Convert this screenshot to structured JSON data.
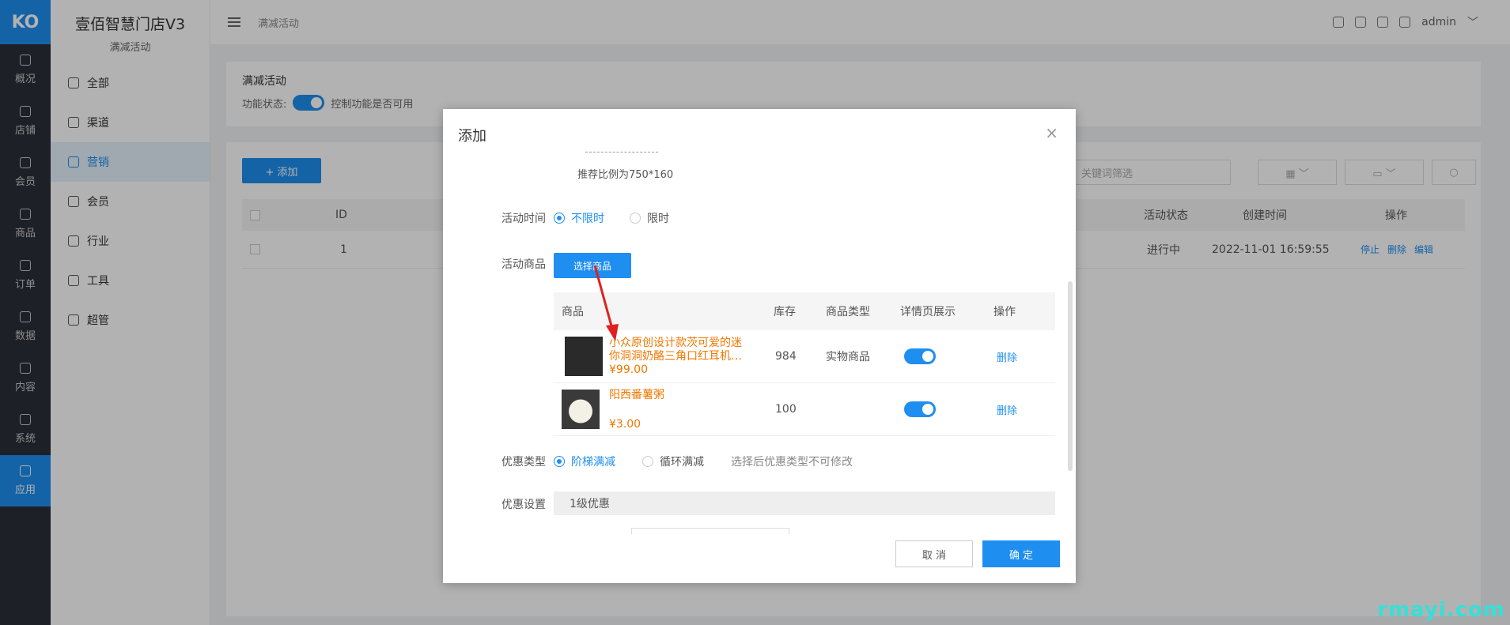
{
  "rail": {
    "logo": "KO",
    "items": [
      {
        "label": "概况"
      },
      {
        "label": "店铺"
      },
      {
        "label": "会员"
      },
      {
        "label": "商品"
      },
      {
        "label": "订单"
      },
      {
        "label": "数据"
      },
      {
        "label": "内容"
      },
      {
        "label": "系统"
      },
      {
        "label": "应用"
      }
    ],
    "active_index": 8
  },
  "sidebar": {
    "brand": "壹佰智慧门店V3",
    "subtitle": "满减活动",
    "items": [
      {
        "label": "全部"
      },
      {
        "label": "渠道"
      },
      {
        "label": "营销"
      },
      {
        "label": "会员"
      },
      {
        "label": "行业"
      },
      {
        "label": "工具"
      },
      {
        "label": "超管"
      }
    ],
    "active_index": 2
  },
  "header": {
    "breadcrumb": "满减活动",
    "user": "admin"
  },
  "page": {
    "title": "满减活动",
    "status_label": "功能状态:",
    "status_desc": "控制功能是否可用",
    "add_button": "+ 添加",
    "search_placeholder": "关键词筛选",
    "table": {
      "headers": [
        "ID",
        "活动状态",
        "创建时间",
        "操作"
      ],
      "rows": [
        {
          "id": "1",
          "status": "进行中",
          "created": "2022-11-01 16:59:55",
          "actions": [
            "停止",
            "删除",
            "编辑"
          ]
        }
      ]
    }
  },
  "modal": {
    "title": "添加",
    "close": "×",
    "image_hint": "推荐比例为750*160",
    "time_label": "活动时间",
    "time_options": [
      "不限时",
      "限时"
    ],
    "time_selected": 0,
    "goods_label": "活动商品",
    "pick_button": "选择商品",
    "goods_headers": [
      "商品",
      "库存",
      "商品类型",
      "详情页展示",
      "操作"
    ],
    "goods": [
      {
        "name": "小众原创设计款茨可爱的迷你洞洞奶酪三角口红耳机…",
        "price": "¥99.00",
        "stock": "984",
        "type": "实物商品",
        "show": true,
        "action": "删除"
      },
      {
        "name": "阳西番薯粥",
        "price": "¥3.00",
        "stock": "100",
        "type": "",
        "show": true,
        "action": "删除"
      }
    ],
    "discount_label": "优惠类型",
    "discount_options": [
      "阶梯满减",
      "循环满减"
    ],
    "discount_selected": 0,
    "discount_note": "选择后优惠类型不可修改",
    "setting_label": "优惠设置",
    "level_label": "1级优惠",
    "cancel": "取 消",
    "ok": "确 定"
  },
  "watermark": "rmayi.com",
  "colors": {
    "accent": "#1e8ef0",
    "price": "#f07700"
  }
}
